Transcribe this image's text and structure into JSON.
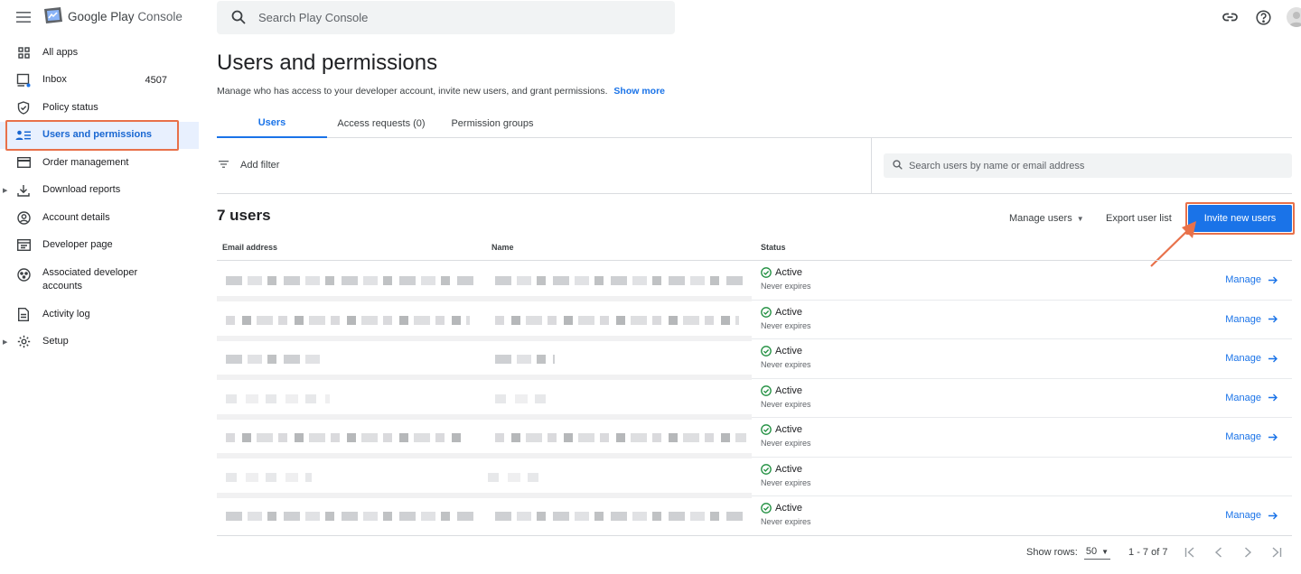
{
  "app": {
    "brand_google": "Google Play",
    "brand_console": "Console",
    "search_placeholder": "Search Play Console"
  },
  "sidebar": {
    "items": [
      {
        "label": "All apps",
        "icon": "grid-icon"
      },
      {
        "label": "Inbox",
        "icon": "inbox-icon",
        "count": "4507"
      },
      {
        "label": "Policy status",
        "icon": "shield-icon"
      },
      {
        "label": "Users and permissions",
        "icon": "people-list-icon",
        "active": true
      },
      {
        "label": "Order management",
        "icon": "credit-card-icon"
      },
      {
        "label": "Download reports",
        "icon": "download-icon",
        "expandable": true
      },
      {
        "label": "Account details",
        "icon": "account-circle-icon"
      },
      {
        "label": "Developer page",
        "icon": "web-page-icon"
      },
      {
        "label": "Associated developer accounts",
        "icon": "linked-accounts-icon"
      },
      {
        "label": "Activity log",
        "icon": "document-icon"
      },
      {
        "label": "Setup",
        "icon": "gear-icon",
        "expandable": true
      }
    ]
  },
  "header": {
    "title": "Users and permissions",
    "description": "Manage who has access to your developer account, invite new users, and grant permissions.",
    "show_more": "Show more"
  },
  "tabs": [
    {
      "label": "Users",
      "active": true
    },
    {
      "label": "Access requests (0)"
    },
    {
      "label": "Permission groups"
    }
  ],
  "filter": {
    "add_filter": "Add filter",
    "search_placeholder": "Search users by name or email address"
  },
  "users": {
    "count_label": "7 users",
    "manage_users": "Manage users",
    "export_user_list": "Export user list",
    "invite_button": "Invite new users",
    "columns": {
      "email": "Email address",
      "name": "Name",
      "status": "Status"
    },
    "rows": [
      {
        "status": "Active",
        "expiry": "Never expires",
        "action": "Manage"
      },
      {
        "status": "Active",
        "expiry": "Never expires",
        "action": "Manage"
      },
      {
        "status": "Active",
        "expiry": "Never expires",
        "action": "Manage"
      },
      {
        "status": "Active",
        "expiry": "Never expires",
        "action": "Manage"
      },
      {
        "status": "Active",
        "expiry": "Never expires",
        "action": "Manage"
      },
      {
        "status": "Active",
        "expiry": "Never expires",
        "action": ""
      },
      {
        "status": "Active",
        "expiry": "Never expires",
        "action": "Manage"
      }
    ]
  },
  "pagination": {
    "show_rows_label": "Show rows:",
    "rows_value": "50",
    "range": "1 - 7 of 7"
  },
  "colors": {
    "accent": "#1a73e8",
    "active_bg": "#e8f0fe",
    "annotation": "#e8714a",
    "status_ok": "#1e8e3e"
  }
}
